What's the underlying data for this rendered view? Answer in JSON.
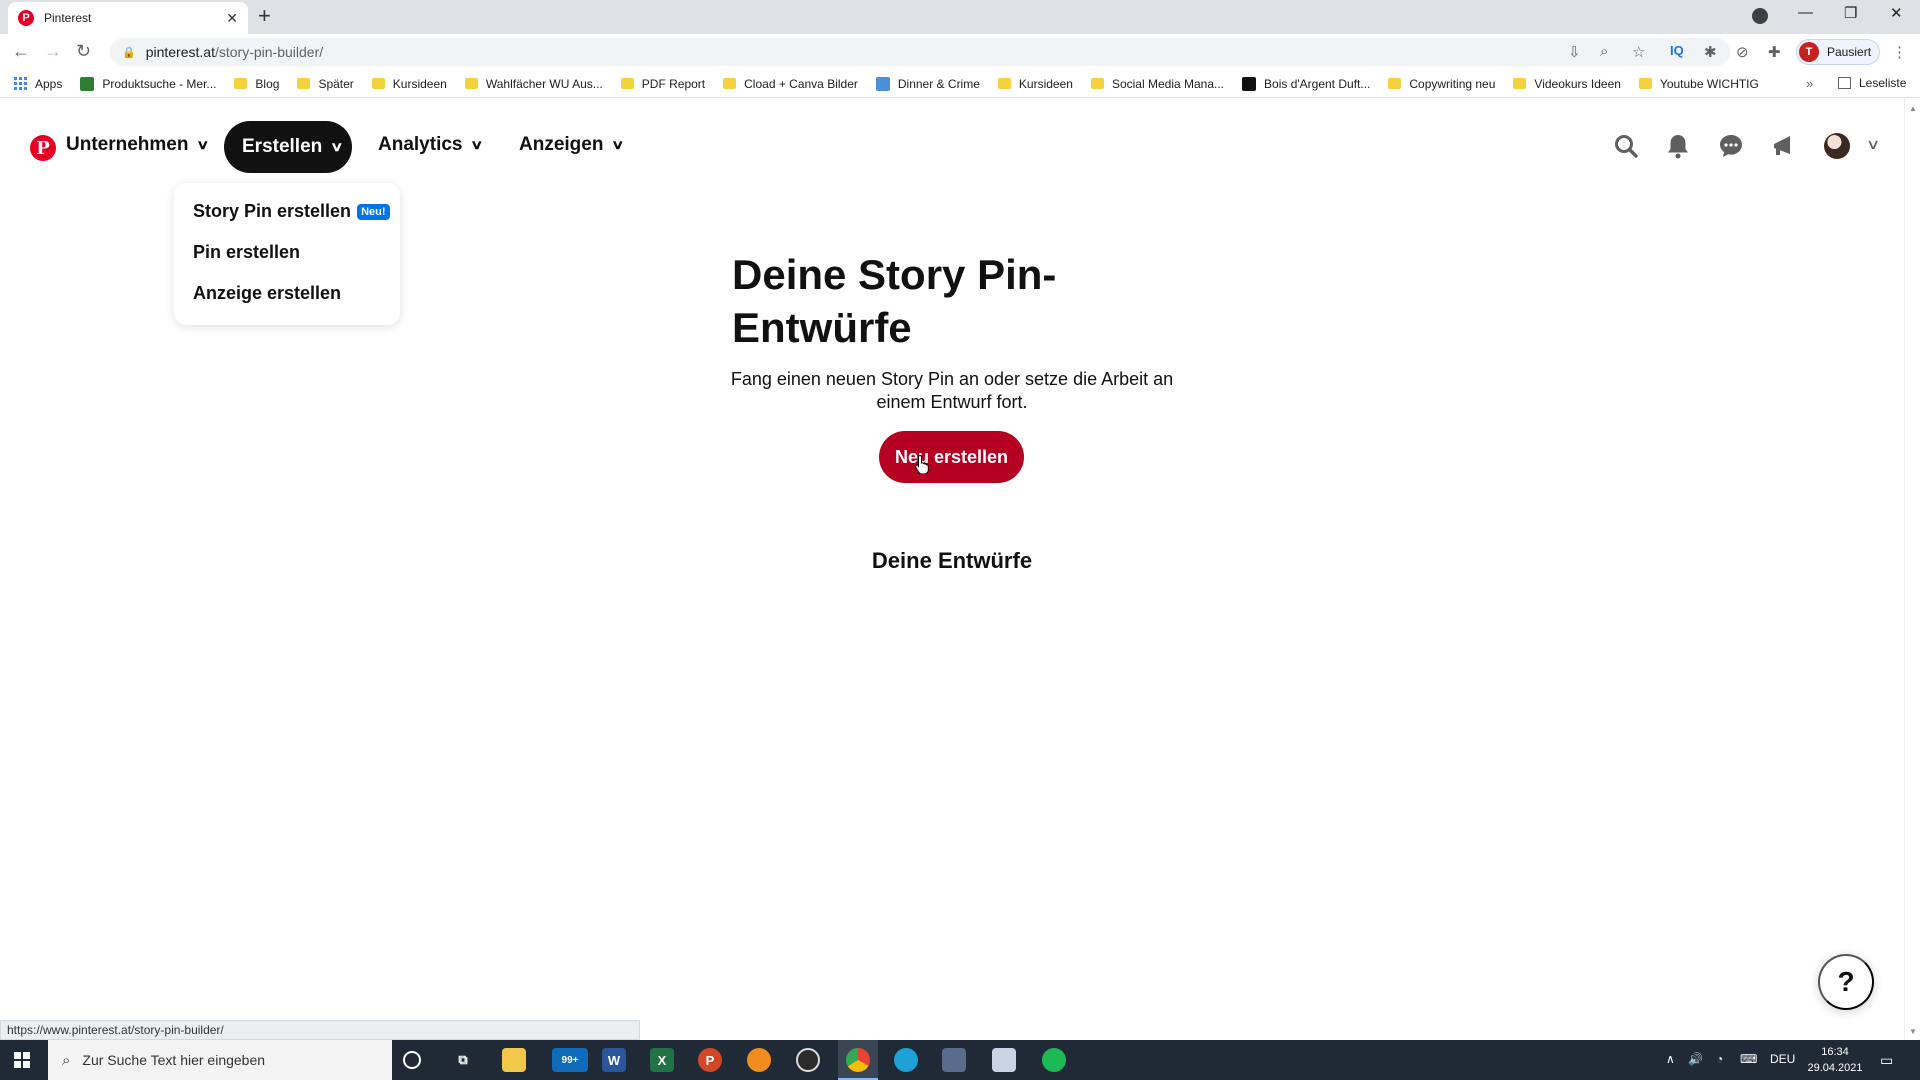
{
  "browser": {
    "tab_title": "Pinterest",
    "tab_favicon": "P",
    "new_tab": "+",
    "url_domain": "pinterest.at",
    "url_path": "/story-pin-builder/",
    "profile_initial": "T",
    "profile_label": "Pausiert",
    "bookmarks": [
      {
        "label": "Apps",
        "icon": "apps-icon"
      },
      {
        "label": "Produktsuche - Mer...",
        "icon": "site-icon"
      },
      {
        "label": "Blog",
        "icon": "folder-icon"
      },
      {
        "label": "Später",
        "icon": "folder-icon"
      },
      {
        "label": "Kursideen",
        "icon": "folder-icon"
      },
      {
        "label": "Wahlfächer WU Aus...",
        "icon": "folder-icon"
      },
      {
        "label": "PDF Report",
        "icon": "folder-icon"
      },
      {
        "label": "Cload + Canva Bilder",
        "icon": "folder-icon"
      },
      {
        "label": "Dinner & Crime",
        "icon": "site-icon"
      },
      {
        "label": "Kursideen",
        "icon": "folder-icon"
      },
      {
        "label": "Social Media Mana...",
        "icon": "folder-icon"
      },
      {
        "label": "Bois d'Argent Duft...",
        "icon": "site-icon"
      },
      {
        "label": "Copywriting neu",
        "icon": "folder-icon"
      },
      {
        "label": "Videokurs Ideen",
        "icon": "folder-icon"
      },
      {
        "label": "Youtube WICHTIG",
        "icon": "folder-icon"
      }
    ],
    "bookmarks_more": "»",
    "reading_list": "Leseliste",
    "status_url": "https://www.pinterest.at/story-pin-builder/"
  },
  "pinterest": {
    "logo": "P",
    "nav": {
      "business": "Unternehmen",
      "create": "Erstellen",
      "analytics": "Analytics",
      "ads": "Anzeigen"
    },
    "dropdown": {
      "items": [
        {
          "label": "Story Pin erstellen",
          "badge": "Neu!"
        },
        {
          "label": "Pin erstellen"
        },
        {
          "label": "Anzeige erstellen"
        }
      ]
    },
    "main": {
      "title": "Deine Story Pin-Entwürfe",
      "subtitle": "Fang einen neuen Story Pin an oder setze die Arbeit an einem Entwurf fort.",
      "cta": "Neu erstellen",
      "drafts_heading": "Deine Entwürfe"
    },
    "help": "?",
    "colors": {
      "brand": "#e60023",
      "cta": "#b60021",
      "nav_active": "#111111",
      "badge": "#0074e8"
    }
  },
  "taskbar": {
    "search_placeholder": "Zur Suche Text hier eingeben",
    "mail_badge": "99+",
    "language": "DEU",
    "time": "16:34",
    "date": "29.04.2021"
  }
}
